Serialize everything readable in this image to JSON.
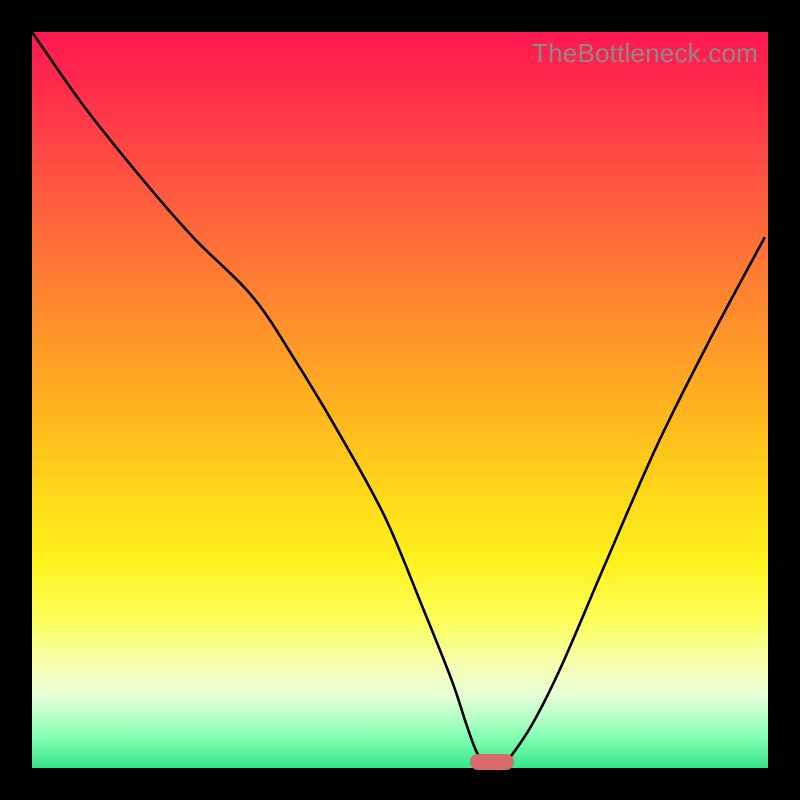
{
  "watermark": "TheBottleneck.com",
  "chart_data": {
    "type": "line",
    "title": "",
    "xlabel": "",
    "ylabel": "",
    "xlim": [
      0,
      100
    ],
    "ylim": [
      0,
      100
    ],
    "grid": false,
    "legend": false,
    "series": [
      {
        "name": "bottleneck-curve",
        "x": [
          0,
          7,
          15,
          22,
          30,
          36,
          42,
          48,
          53,
          57,
          59,
          60.5,
          62,
          63,
          64,
          65,
          68,
          72,
          78,
          85,
          92,
          99.5
        ],
        "y": [
          100,
          90,
          80,
          72,
          64,
          55,
          45,
          34,
          22,
          12,
          6,
          2,
          0.5,
          0.5,
          0.5,
          1.5,
          6,
          14,
          28,
          44,
          58,
          72
        ]
      }
    ],
    "marker": {
      "x": 62.5,
      "y": 0.8,
      "color": "#d96b6a"
    },
    "gradient_stops": [
      {
        "pos": 0,
        "color": "#ff1850"
      },
      {
        "pos": 22,
        "color": "#ff5a3f"
      },
      {
        "pos": 52,
        "color": "#ffb61e"
      },
      {
        "pos": 72,
        "color": "#fff21e"
      },
      {
        "pos": 90,
        "color": "#e6ffd6"
      },
      {
        "pos": 100,
        "color": "#35e58a"
      }
    ]
  }
}
